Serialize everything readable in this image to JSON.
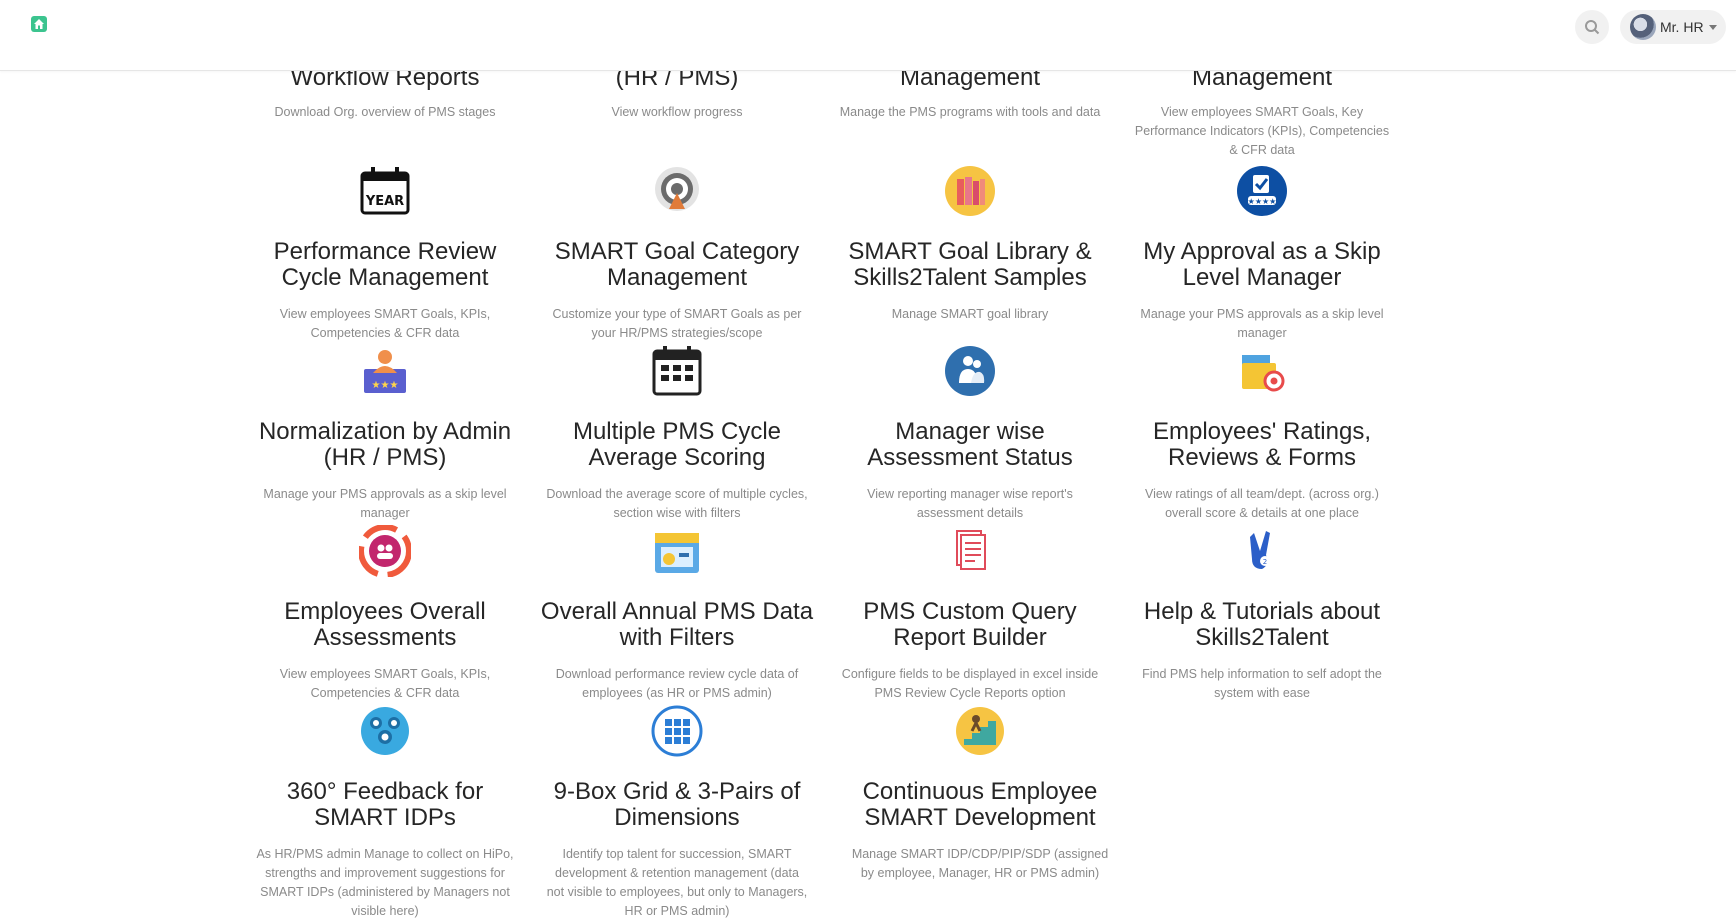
{
  "topbar": {
    "user_name": "Mr. HR",
    "icons": {
      "home": "home-icon",
      "search": "search-icon",
      "caret": "chevron-down-icon"
    }
  },
  "colors": {
    "brand_green": "#3cc48f",
    "title_text": "#262626",
    "desc_text": "#8a8a8a"
  },
  "cards": [
    {
      "title": "Workflow Reports",
      "desc": "Download Org. overview of PMS stages"
    },
    {
      "title": "(HR / PMS)",
      "desc": "View workflow progress"
    },
    {
      "title": "Management",
      "desc": "Manage the PMS programs with tools and data"
    },
    {
      "title": "Management",
      "desc": "View employees SMART Goals, Key Performance Indicators (KPIs), Competencies & CFR data"
    },
    {
      "title": "Performance Review Cycle Management",
      "desc": "View employees SMART Goals, KPIs, Competencies & CFR data",
      "icon": "year-calendar-icon"
    },
    {
      "title": "SMART Goal Category Management",
      "desc": "Customize your type of SMART Goals as per your HR/PMS strategies/scope",
      "icon": "target-icon"
    },
    {
      "title": "SMART Goal Library & Skills2Talent Samples",
      "desc": "Manage SMART goal library",
      "icon": "books-icon"
    },
    {
      "title": "My Approval as a Skip Level Manager",
      "desc": "Manage your PMS approvals as a skip level manager",
      "icon": "approval-badge-icon"
    },
    {
      "title": "Normalization by Admin (HR / PMS)",
      "desc": "Manage your PMS approvals as a skip level manager",
      "icon": "admin-rating-icon"
    },
    {
      "title": "Multiple PMS Cycle Average Scoring",
      "desc": "Download the average score of multiple cycles, section wise with filters",
      "icon": "calendar-grid-icon"
    },
    {
      "title": "Manager wise Assessment Status",
      "desc": "View reporting manager wise report's assessment details",
      "icon": "team-icon"
    },
    {
      "title": "Employees' Ratings, Reviews & Forms",
      "desc": "View ratings of all team/dept. (across org.) overall score & details at one place",
      "icon": "folder-target-icon"
    },
    {
      "title": "Employees Overall Assessments",
      "desc": "View employees SMART Goals, KPIs, Competencies & CFR data",
      "icon": "users-ring-icon"
    },
    {
      "title": "Overall Annual PMS Data with Filters",
      "desc": "Download performance review cycle data of employees (as HR or PMS admin)",
      "icon": "annual-calendar-chart-icon"
    },
    {
      "title": "PMS Custom Query Report Builder",
      "desc": "Configure fields to be displayed in excel inside PMS Review Cycle Reports option",
      "icon": "report-list-icon"
    },
    {
      "title": "Help & Tutorials about Skills2Talent",
      "desc": "Find PMS help information to self adopt the system with ease",
      "icon": "victory-hand-icon"
    },
    {
      "title": "360° Feedback for SMART IDPs",
      "desc": "As HR/PMS admin Manage to collect on HiPo, strengths and improvement suggestions for SMART IDPs (administered by Managers not visible here)",
      "icon": "people-network-icon"
    },
    {
      "title": "9-Box Grid & 3-Pairs of Dimensions",
      "desc": "Identify top talent for succession, SMART development & retention management (data not visible to employees, but only to Managers, HR or PMS admin)",
      "icon": "nine-box-grid-icon"
    },
    {
      "title": "Continuous Employee SMART Development",
      "desc": "Manage SMART IDP/CDP/PIP/SDP (assigned by employee, Manager, HR or PMS admin)",
      "icon": "stairs-growth-icon"
    }
  ]
}
